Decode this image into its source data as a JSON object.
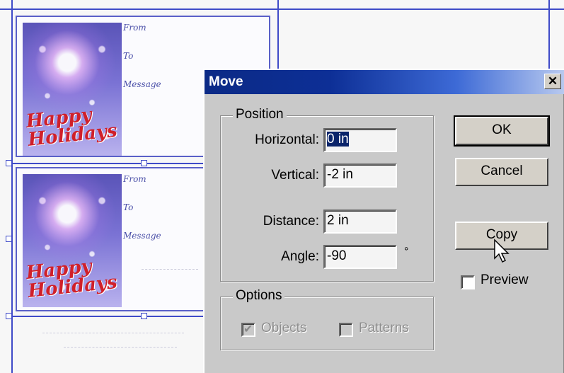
{
  "document": {
    "cards": [
      {
        "holiday_text": "Happy Holidays",
        "from_label": "From",
        "to_label": "To",
        "message_label": "Message"
      },
      {
        "holiday_text": "Happy Holidays",
        "from_label": "From",
        "to_label": "To",
        "message_label": "Message"
      }
    ]
  },
  "dialog": {
    "title": "Move",
    "close_glyph": "✕",
    "position_group": {
      "legend": "Position",
      "horizontal_label": "Horizontal:",
      "horizontal_value": "0 in",
      "vertical_label": "Vertical:",
      "vertical_value": "-2 in",
      "distance_label": "Distance:",
      "distance_value": "2 in",
      "angle_label": "Angle:",
      "angle_value": "-90",
      "degree_symbol": "°"
    },
    "options_group": {
      "legend": "Options",
      "objects_label": "Objects",
      "objects_checked": true,
      "patterns_label": "Patterns",
      "patterns_checked": false
    },
    "buttons": {
      "ok": "OK",
      "cancel": "Cancel",
      "copy": "Copy"
    },
    "preview": {
      "label": "Preview",
      "checked": false
    }
  },
  "colors": {
    "titlebar_start": "#0b2a86",
    "titlebar_end": "#b8c9ef",
    "guide": "#3f4bc8",
    "dialog_face": "#c9c9c9",
    "holiday_red": "#d0202a"
  },
  "icons": [
    "close-icon",
    "checkbox-icon",
    "arrow-cursor-icon"
  ]
}
